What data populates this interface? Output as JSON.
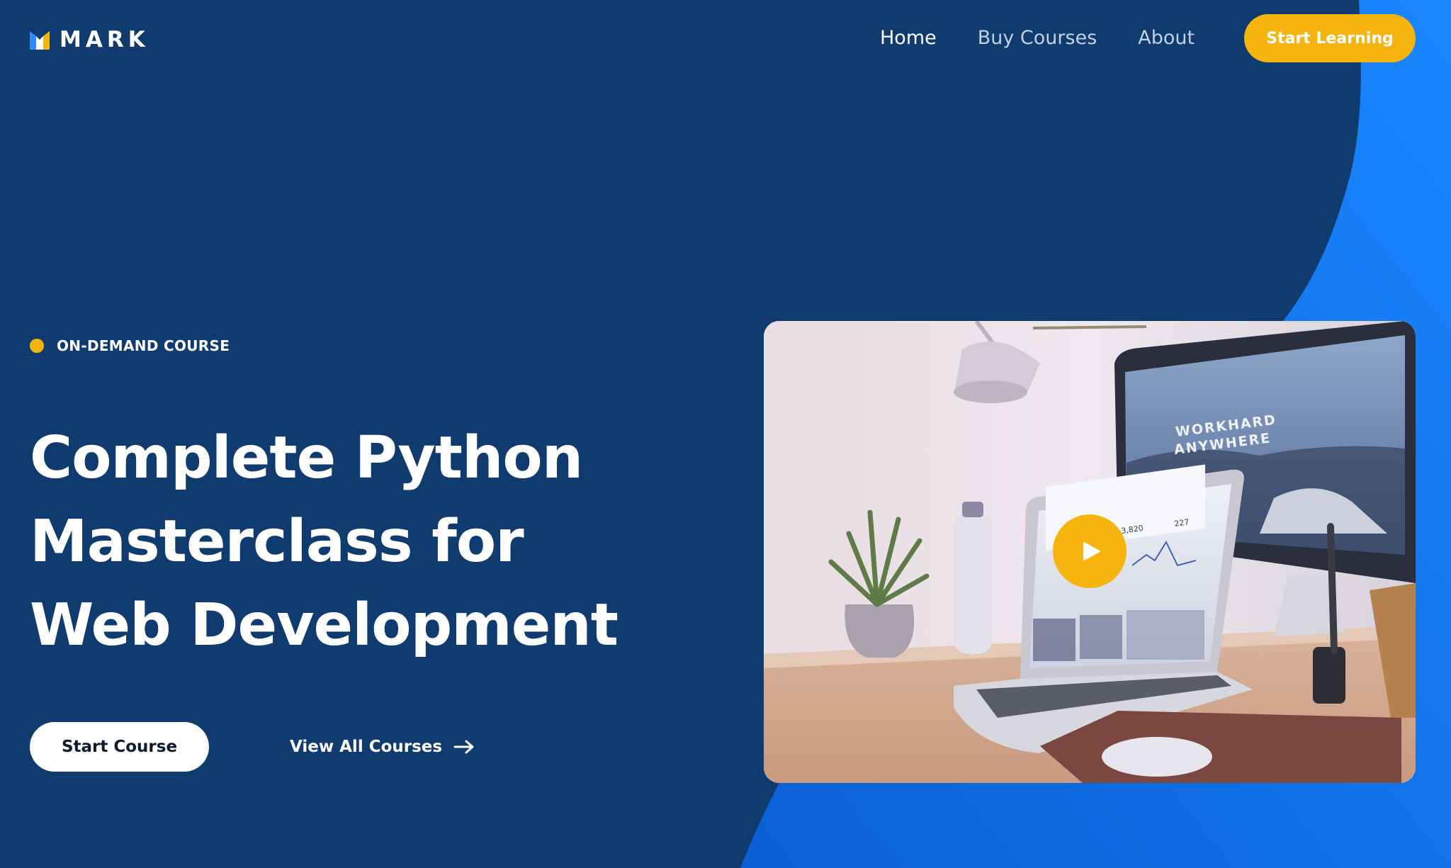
{
  "brand": {
    "name": "MARK",
    "icon": "mark-logo-icon"
  },
  "nav": {
    "items": [
      {
        "label": "Home",
        "active": true
      },
      {
        "label": "Buy Courses",
        "active": false
      },
      {
        "label": "About",
        "active": false
      }
    ],
    "cta_label": "Start Learning"
  },
  "hero": {
    "eyebrow": "ON-DEMAND COURSE",
    "title_lines": [
      "Complete Python",
      "Masterclass for",
      "Web Development"
    ],
    "primary_button": "Start Course",
    "secondary_link": "View All Courses",
    "secondary_icon": "arrow-right-icon"
  },
  "video": {
    "screen_text_line1": "WORKHARD",
    "screen_text_line2": "ANYWHERE",
    "laptop_stat_1": "3,820",
    "laptop_stat_2": "227",
    "play_icon": "play-icon"
  },
  "colors": {
    "background": "#0f3b6e",
    "accent_blue": "#1478f0",
    "accent_yellow": "#f6b50e",
    "text": "#ffffff",
    "nav_inactive": "#c3d0e1"
  }
}
